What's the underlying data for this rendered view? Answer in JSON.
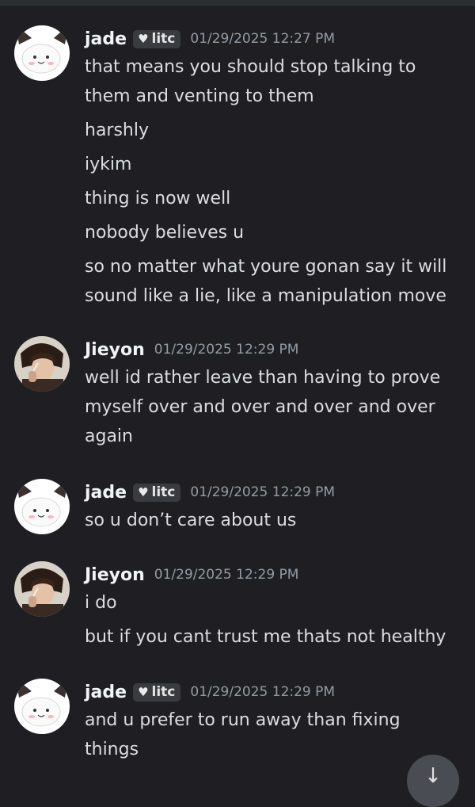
{
  "messages": [
    {
      "username": "jade",
      "tag": "litc",
      "timestamp": "01/29/2025 12:27 PM",
      "lines": [
        "that means you should stop talking to",
        "them and venting to them",
        "harshly",
        "iykim",
        "thing is now well",
        "nobody believes u",
        "so no matter what youre gonan say it will",
        "sound like a lie, like a manipulation move"
      ]
    },
    {
      "username": "Jieyon",
      "timestamp": "01/29/2025 12:29 PM",
      "lines": [
        "well id rather leave than having to prove",
        "myself over and over and over and over",
        "again"
      ]
    },
    {
      "username": "jade",
      "tag": "litc",
      "timestamp": "01/29/2025 12:29 PM",
      "lines": [
        "so u don’t care about us"
      ]
    },
    {
      "username": "Jieyon",
      "timestamp": "01/29/2025 12:29 PM",
      "lines": [
        "i do",
        "but if you cant trust me thats not healthy"
      ]
    },
    {
      "username": "jade",
      "tag": "litc",
      "timestamp": "01/29/2025 12:29 PM",
      "lines": [
        "and u prefer to run away than fixing",
        "things"
      ]
    }
  ],
  "tag_icon": "heart-icon",
  "scroll_icon": "arrow-down-icon",
  "colors": {
    "background": "#1f1f23",
    "username": "#f2f3f5",
    "timestamp": "#949ba4",
    "text": "#dcdde1",
    "tag_bg": "#3a3b41"
  }
}
